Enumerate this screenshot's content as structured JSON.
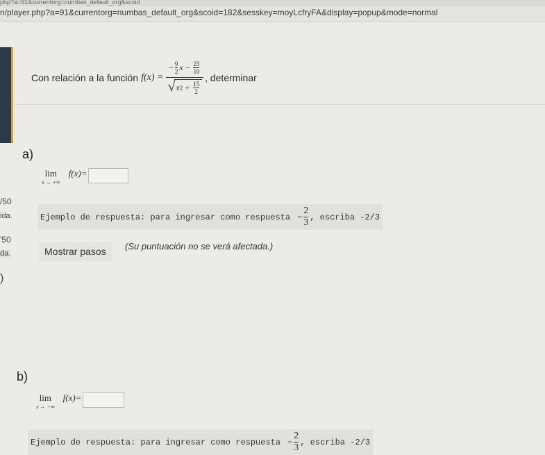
{
  "browser": {
    "title_fragment": "php?a=91&currentorg=numbas_default_org&scoid",
    "url": "n/player.php?a=91&currentorg=numbas_default_org&scoid=182&sesskey=moyLcfryFA&display=popup&mode=normal"
  },
  "left_column": {
    "score_1": "/50",
    "status_1": "ida.",
    "score_2": "'50",
    "status_2": "da.",
    "marker": ")"
  },
  "question": {
    "intro": "Con relación a la función",
    "func": "f(x) =",
    "num_sign": "−",
    "num_a_top": "9",
    "num_a_bottom": "2",
    "num_x": "x",
    "num_minus": "−",
    "num_b_top": "23",
    "num_b_bottom": "10",
    "den_x2": "x",
    "den_exp": "2",
    "den_plus": "+",
    "den_c_top": "15",
    "den_c_bottom": "2",
    "suffix": ", determinar"
  },
  "part_a": {
    "label": "a)",
    "lim": "lim",
    "sub": "x → +∞",
    "expr": "f(x)=",
    "answer": "",
    "hint_text": "Ejemplo de respuesta: para ingresar como respuesta",
    "hint_sign": "−",
    "hint_num": "2",
    "hint_den": "3",
    "hint_after": ", escriba -2/3",
    "show_steps": "Mostrar pasos",
    "note": "(Su puntuación no se verá afectada.)"
  },
  "part_b": {
    "label": "b)",
    "lim": "lim",
    "sub": "x → −∞",
    "expr": "f(x)=",
    "answer": "",
    "hint_text": "Ejemplo de respuesta: para ingresar como respuesta",
    "hint_sign": "−",
    "hint_num": "2",
    "hint_den": "3",
    "hint_after": ", escriba -2/3"
  }
}
